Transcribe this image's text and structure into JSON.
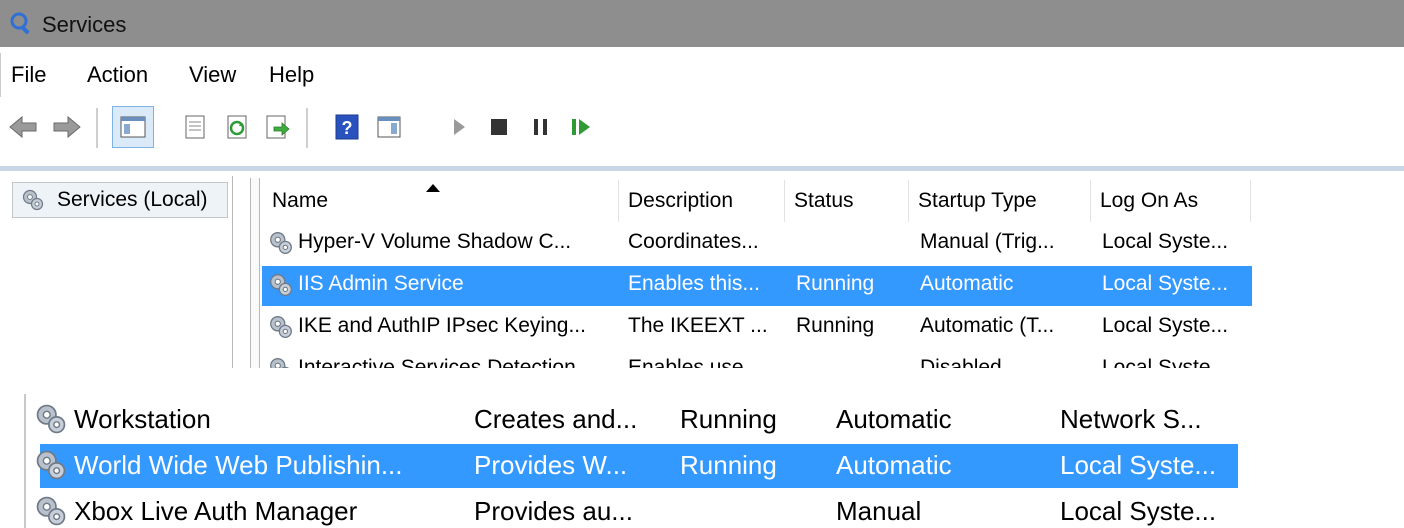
{
  "window": {
    "title": "Services"
  },
  "menu": [
    "File",
    "Action",
    "View",
    "Help"
  ],
  "toolbar": {
    "icons": [
      "back-arrow-icon",
      "forward-arrow-icon",
      "show-hide-console-tree-icon",
      "properties-icon",
      "refresh-icon",
      "export-list-icon",
      "help-icon",
      "show-action-pane-icon",
      "start-service-icon",
      "stop-service-icon",
      "pause-service-icon",
      "resume-service-icon"
    ]
  },
  "left_pane": {
    "item": "Services (Local)"
  },
  "columns": [
    "Name",
    "Description",
    "Status",
    "Startup Type",
    "Log On As"
  ],
  "top_rows": [
    {
      "name": "Hyper-V Volume Shadow C...",
      "description": "Coordinates...",
      "status": "",
      "startup": "Manual (Trig...",
      "logon": "Local Syste...",
      "selected": false
    },
    {
      "name": "IIS Admin Service",
      "description": "Enables this...",
      "status": "Running",
      "startup": "Automatic",
      "logon": "Local Syste...",
      "selected": true
    },
    {
      "name": "IKE and AuthIP IPsec Keying...",
      "description": "The IKEEXT ...",
      "status": "Running",
      "startup": "Automatic (T...",
      "logon": "Local Syste...",
      "selected": false
    },
    {
      "name": "Interactive Services Detection",
      "description": "Enables use...",
      "status": "",
      "startup": "Disabled",
      "logon": "Local Syste...",
      "selected": false
    }
  ],
  "bottom_rows": [
    {
      "name": "Workstation",
      "description": "Creates and...",
      "status": "Running",
      "startup": "Automatic",
      "logon": "Network S...",
      "selected": false
    },
    {
      "name": "World Wide Web Publishin...",
      "description": "Provides W...",
      "status": "Running",
      "startup": "Automatic",
      "logon": "Local Syste...",
      "selected": true
    },
    {
      "name": "Xbox Live Auth Manager",
      "description": "Provides au...",
      "status": "",
      "startup": "Manual",
      "logon": "Local Syste...",
      "selected": false
    }
  ],
  "colors": {
    "selection": "#3399ff",
    "titlebar": "#8e8e8e",
    "selected_text": "#ffffff"
  }
}
